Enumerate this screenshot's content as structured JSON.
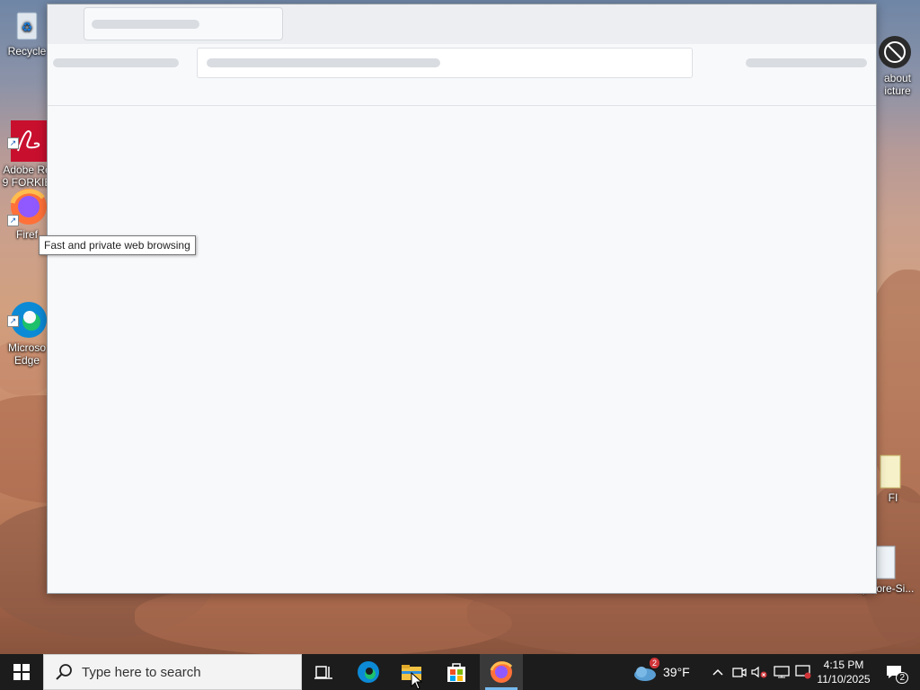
{
  "desktop": {
    "icons": [
      {
        "label": "Recycle",
        "icon": "recycle-bin-icon"
      },
      {
        "label": "Adobe Re\n9 FORKIE",
        "icon": "adobe-reader-icon"
      },
      {
        "label": "Firef",
        "icon": "firefox-icon"
      },
      {
        "label": "Microso\nEdge",
        "icon": "edge-icon"
      },
      {
        "label": "about\nicture",
        "icon": "no-symbol-icon"
      },
      {
        "label": "FI",
        "icon": "file-icon"
      },
      {
        "label": "OpCore-Si...",
        "icon": "file-icon"
      }
    ]
  },
  "tooltip": {
    "text": "Fast and private web browsing"
  },
  "taskbar": {
    "search_placeholder": "Type here to search",
    "weather": {
      "temp": "39°F",
      "badge": "2"
    },
    "clock": {
      "time": "4:15 PM",
      "date": "11/10/2025"
    },
    "notifications_count": "2"
  },
  "colors": {
    "taskbar": "#1c1c1c",
    "accent": "#76b9ed"
  }
}
